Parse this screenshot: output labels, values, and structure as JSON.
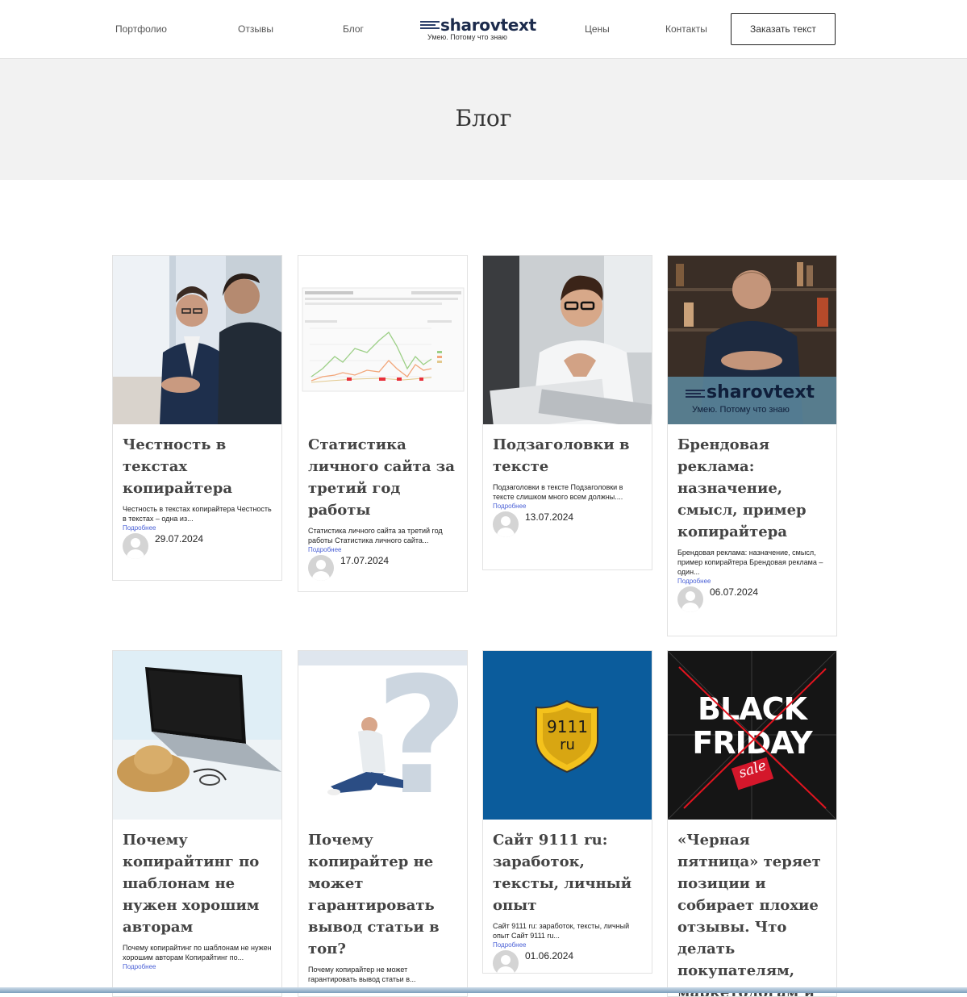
{
  "nav": {
    "items": [
      "Портфолио",
      "Отзывы",
      "Блог",
      "Цены",
      "Контакты"
    ],
    "order_button": "Заказать текст"
  },
  "logo": {
    "text": "sharovtext",
    "slogan": "Умею. Потому что знаю"
  },
  "hero": {
    "title": "Блог"
  },
  "posts": [
    {
      "title": "Честность в текстах копирайтера",
      "excerpt": "Честность в текстах копирайтера Честность в текстах – одна из...",
      "more": "Подробнее",
      "date": "29.07.2024",
      "image": "business-meeting-photo"
    },
    {
      "title": "Статистика личного сайта за третий год работы",
      "excerpt": "Статистика личного сайта за третий год работы Статистика личного сайта...",
      "more": "Подробнее",
      "date": "17.07.2024",
      "image": "analytics-chart-screenshot"
    },
    {
      "title": "Подзаголовки в тексте",
      "excerpt": "Подзаголовки в тексте Подзаголовки в тексте слишком много всем должны....",
      "more": "Подробнее",
      "date": "13.07.2024",
      "image": "man-thinking-laptop-photo"
    },
    {
      "title": "Брендовая реклама: назначение, смысл, пример копирайтера",
      "excerpt": "Брендовая реклама: назначение, смысл, пример копирайтера Брендовая реклама – один...",
      "more": "Подробнее",
      "date": "06.07.2024",
      "image": "author-portrait-photo",
      "overlay_logo": "sharovtext",
      "overlay_slogan": "Умею. Потому что знаю"
    },
    {
      "title": "Почему копирайтинг по шаблонам не нужен хорошим авторам",
      "excerpt": "Почему копирайтинг по шаблонам не нужен хорошим авторам Копирайтинг по...",
      "more": "Подробнее",
      "image": "laptop-beach-photo"
    },
    {
      "title": "Почему копирайтер не может гарантировать вывод статьи в топ?",
      "excerpt": "Почему копирайтер не может гарантировать вывод статьи в...",
      "image": "man-question-mark-photo"
    },
    {
      "title": "Сайт 9111 ru: заработок, тексты, личный опыт",
      "excerpt": "Сайт 9111 ru: заработок, тексты, личный опыт Сайт 9111 ru...",
      "more": "Подробнее",
      "date": "01.06.2024",
      "image": "9111-shield-logo",
      "badge_top": "9111",
      "badge_bottom": "ru"
    },
    {
      "title": "«Черная пятница» теряет позиции и собирает плохие отзывы. Что делать покупателям, маркетологам и копирайтерам",
      "image": "black-friday-crossed-poster",
      "poster_line1": "BLACK",
      "poster_line2": "FRIDAY",
      "poster_sale": "sale"
    }
  ],
  "colors": {
    "accent_link": "#4b61d6",
    "logo": "#1c2b4c",
    "hero_bg": "#f2f2f2",
    "tile_blue": "#0b5c9c"
  }
}
